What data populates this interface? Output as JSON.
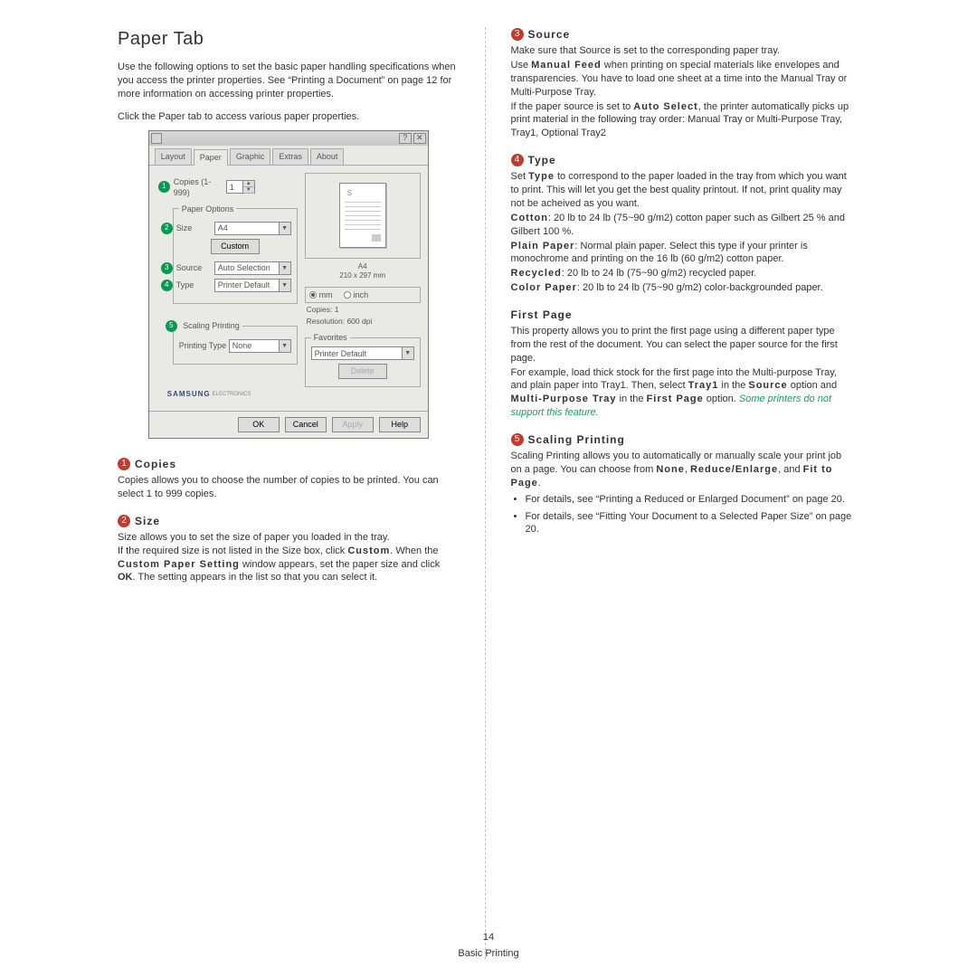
{
  "page": {
    "title": "Paper Tab",
    "intro1": "Use the following options to set the basic paper handling specifications when you access the printer properties. See “Printing a Document” on page 12 for more information on accessing printer properties.",
    "intro2": "Click the Paper tab to access various paper properties.",
    "footer_page": "14",
    "footer_label": "Basic Printing"
  },
  "mock": {
    "title_help": "?",
    "title_close": "✕",
    "tabs": {
      "layout": "Layout",
      "paper": "Paper",
      "graphic": "Graphic",
      "extras": "Extras",
      "about": "About"
    },
    "copies_label": "Copies (1-999)",
    "copies_value": "1",
    "paper_options_legend": "Paper Options",
    "size_label": "Size",
    "size_value": "A4",
    "custom_btn": "Custom",
    "source_label": "Source",
    "source_value": "Auto Selection",
    "type_label": "Type",
    "type_value": "Printer Default",
    "scaling_legend": "Scaling Printing",
    "printing_type_label": "Printing Type",
    "printing_type_value": "None",
    "preview_caption1": "A4",
    "preview_caption2": "210 x 297 mm",
    "unit_mm": "mm",
    "unit_inch": "inch",
    "info_copies": "Copies: 1",
    "info_resolution": "Resolution: 600 dpi",
    "favorites_legend": "Favorites",
    "favorites_value": "Printer Default",
    "delete_btn": "Delete",
    "logo": "SAMSUNG",
    "logo_sub": "ELECTRONICS",
    "ok": "OK",
    "cancel": "Cancel",
    "apply": "Apply",
    "help": "Help"
  },
  "sections": {
    "copies": {
      "num": "1",
      "title": "Copies",
      "body": "Copies allows you to choose the number of copies to be printed. You can select 1 to 999 copies."
    },
    "size": {
      "num": "2",
      "title": "Size",
      "p1a": "Size allows you to set the size of paper you loaded in the tray.",
      "p2a": "If the required size is not listed in the Size box, click ",
      "p2b": "Custom",
      "p2c": ". When the ",
      "p2d": "Custom Paper Setting",
      "p2e": " window appears, set the paper size and click ",
      "p2f": "OK",
      "p2g": ". The setting appears in the list so that you can select it."
    },
    "source": {
      "num": "3",
      "title": "Source",
      "p1": "Make sure that Source is set to the corresponding paper tray.",
      "p2a": "Use ",
      "p2b": "Manual Feed",
      "p2c": " when printing on special materials like envelopes and transparencies. You have to load one sheet at a time into the Manual Tray or Multi-Purpose Tray.",
      "p3a": "If the paper source is set to ",
      "p3b": "Auto Select",
      "p3c": ", the printer automatically picks up print material in the following tray order: Manual Tray or Multi-Purpose Tray, Tray1, Optional Tray2"
    },
    "type": {
      "num": "4",
      "title": "Type",
      "p1a": "Set ",
      "p1b": "Type",
      "p1c": " to correspond to the paper loaded in the tray from which you want to print. This will let you get the best quality printout. If not, print quality may not be acheived as you want.",
      "cotton_a": "Cotton",
      "cotton_b": ": 20 lb to 24 lb (75~90 g/m2) cotton paper such as Gilbert 25 % and Gilbert 100 %.",
      "plain_a": "Plain Paper",
      "plain_b": ": Normal plain paper. Select this type if your printer is monochrome and printing on the 16 lb (60 g/m2) cotton paper.",
      "recycled_a": "Recycled",
      "recycled_b": ": 20 lb to 24 lb (75~90 g/m2) recycled paper.",
      "color_a": "Color Paper",
      "color_b": ": 20 lb to 24 lb (75~90 g/m2) color-backgrounded paper."
    },
    "firstpage": {
      "title": "First Page",
      "p1": "This property allows you to print the first page using a different paper type from the rest of the document. You can select the paper source for the first page.",
      "p2a": "For example, load thick stock for the first page into the Multi-purpose Tray, and plain paper into Tray1. Then, select ",
      "p2b": "Tray1",
      "p2c": " in the ",
      "p2d": "Source",
      "p2e": " option and ",
      "p2f": "Multi-Purpose Tray",
      "p2g": " in the ",
      "p2h": "First Page",
      "p2i": " option. ",
      "note": "Some printers do not support this feature."
    },
    "scaling": {
      "num": "5",
      "title": "Scaling Printing",
      "p1a": "Scaling Printing allows you to automatically or manually scale your print job on a page. You can choose from ",
      "p1b": "None",
      "p1c": ", ",
      "p1d": "Reduce/Enlarge",
      "p1e": ", and ",
      "p1f": "Fit to Page",
      "p1g": ".",
      "b1": "For details, see “Printing a Reduced or Enlarged Document” on page 20.",
      "b2": "For details, see “Fitting Your Document to a Selected Paper Size” on page 20."
    }
  }
}
